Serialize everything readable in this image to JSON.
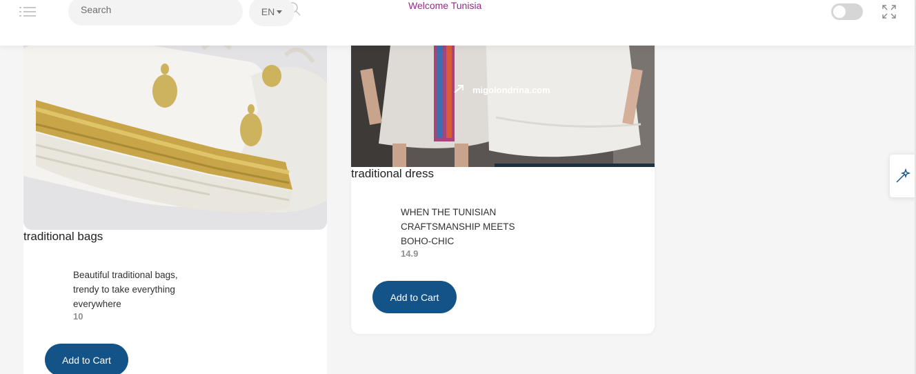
{
  "header": {
    "search": {
      "placeholder": "Search",
      "value": ""
    },
    "language": "EN",
    "welcome": "Welcome Tunisia"
  },
  "products": [
    {
      "title": "traditional bags",
      "description": "Beautiful traditional bags, trendy to take everything everywhere",
      "price": "10",
      "button": "Add to Cart"
    },
    {
      "title": "traditional dress",
      "description": "WHEN THE TUNISIAN CRAFTSMANSHIP MEETS BOHO-CHIC",
      "price": "14.9",
      "button": "Add to Cart",
      "image_watermark": "migolondrina.com"
    }
  ],
  "colors": {
    "primary": "#145388",
    "accent": "#922c88",
    "background": "#f5f5f5"
  },
  "icons": [
    "menu-icon",
    "search-icon",
    "chevron-down-icon",
    "fullscreen-icon",
    "magic-wand-icon"
  ]
}
